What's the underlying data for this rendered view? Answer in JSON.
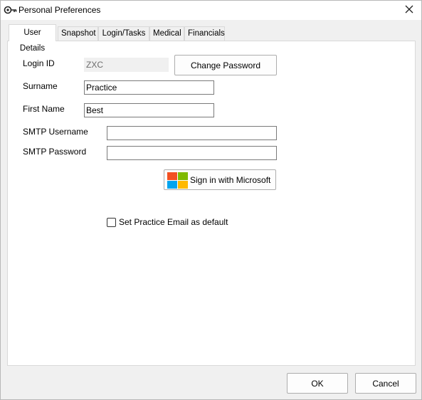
{
  "window": {
    "title": "Personal Preferences",
    "icon": "key-icon",
    "close_icon": "close-icon"
  },
  "tabs": [
    {
      "label": "User Details",
      "active": true
    },
    {
      "label": "Snapshot",
      "active": false
    },
    {
      "label": "Login/Tasks",
      "active": false
    },
    {
      "label": "Medical",
      "active": false
    },
    {
      "label": "Financials",
      "active": false
    }
  ],
  "form": {
    "login_id": {
      "label": "Login ID",
      "value": "ZXC"
    },
    "change_password_label": "Change Password",
    "surname": {
      "label": "Surname",
      "value": "Practice"
    },
    "first_name": {
      "label": "First Name",
      "value": "Best"
    },
    "smtp_username": {
      "label": "SMTP Username",
      "value": ""
    },
    "smtp_password": {
      "label": "SMTP Password",
      "value": ""
    },
    "microsoft_signin_label": "Sign in with Microsoft",
    "default_email": {
      "label": "Set Practice Email as default",
      "checked": false
    }
  },
  "footer": {
    "ok_label": "OK",
    "cancel_label": "Cancel"
  },
  "colors": {
    "ms_red": "#f25022",
    "ms_green": "#7fba00",
    "ms_blue": "#00a4ef",
    "ms_yellow": "#ffb900"
  }
}
